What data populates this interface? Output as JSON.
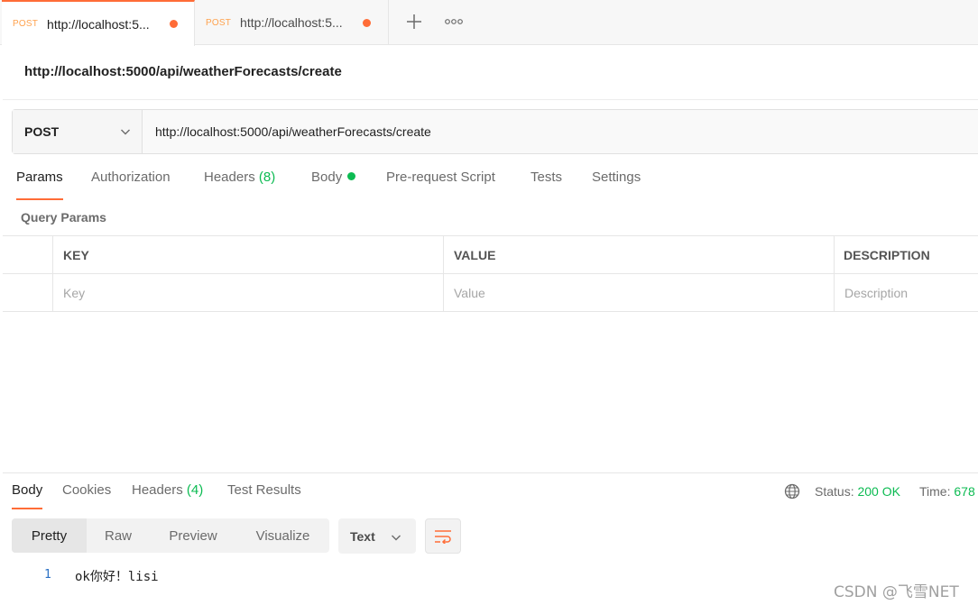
{
  "tabs": [
    {
      "method": "POST",
      "title": "http://localhost:5...",
      "active": true
    },
    {
      "method": "POST",
      "title": "http://localhost:5...",
      "active": false
    }
  ],
  "request": {
    "name": "http://localhost:5000/api/weatherForecasts/create",
    "method": "POST",
    "url": "http://localhost:5000/api/weatherForecasts/create"
  },
  "request_tabs": {
    "params": "Params",
    "authorization": "Authorization",
    "headers": "Headers",
    "headers_count": "(8)",
    "body": "Body",
    "prerequest": "Pre-request Script",
    "tests": "Tests",
    "settings": "Settings"
  },
  "query_params": {
    "title": "Query Params",
    "columns": {
      "key": "KEY",
      "value": "VALUE",
      "description": "DESCRIPTION"
    },
    "placeholders": {
      "key": "Key",
      "value": "Value",
      "description": "Description"
    }
  },
  "response": {
    "tabs": {
      "body": "Body",
      "cookies": "Cookies",
      "headers": "Headers",
      "headers_count": "(4)",
      "test_results": "Test Results"
    },
    "status_label": "Status:",
    "status_value": "200 OK",
    "time_label": "Time:",
    "time_value": "678",
    "views": {
      "pretty": "Pretty",
      "raw": "Raw",
      "preview": "Preview",
      "visualize": "Visualize"
    },
    "format": "Text",
    "line_number": "1",
    "line_text": "ok你好！lisi"
  },
  "watermark": "CSDN @飞雪NET",
  "colors": {
    "accent": "#ff6c37",
    "success": "#0cbb52",
    "method": "#ffa24e"
  }
}
